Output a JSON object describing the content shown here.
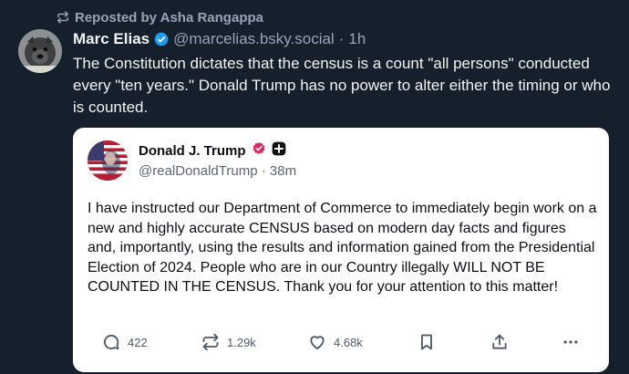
{
  "repost": {
    "label": "Reposted by Asha Rangappa",
    "icon": "repost-icon"
  },
  "post": {
    "author_name": "Marc Elias",
    "handle": "@marcelias.bsky.social",
    "separator": "·",
    "time": "1h",
    "text": "The Constitution dictates that the census is a count \"all persons\" conducted every \"ten years.\" Donald Trump has no power to alter either the timing or who is counted."
  },
  "quote": {
    "author_name": "Donald J. Trump",
    "handle_line": "@realDonaldTrump · 38m",
    "text": "I have instructed our Department of Commerce to immediately begin work on a new and highly accurate CENSUS based on modern day facts and figures and, importantly, using the results and information gained from the Presidential Election of 2024. People who are in our Country illegally WILL NOT BE COUNTED IN THE CENSUS. Thank you for your attention to this matter!",
    "actions": {
      "replies": "422",
      "reposts": "1.29k",
      "likes": "4.68k"
    }
  },
  "colors": {
    "background": "#16202c",
    "muted_text": "#93a5b7",
    "verified_blue": "#1d9bf0",
    "verified_pink": "#e0245e"
  }
}
